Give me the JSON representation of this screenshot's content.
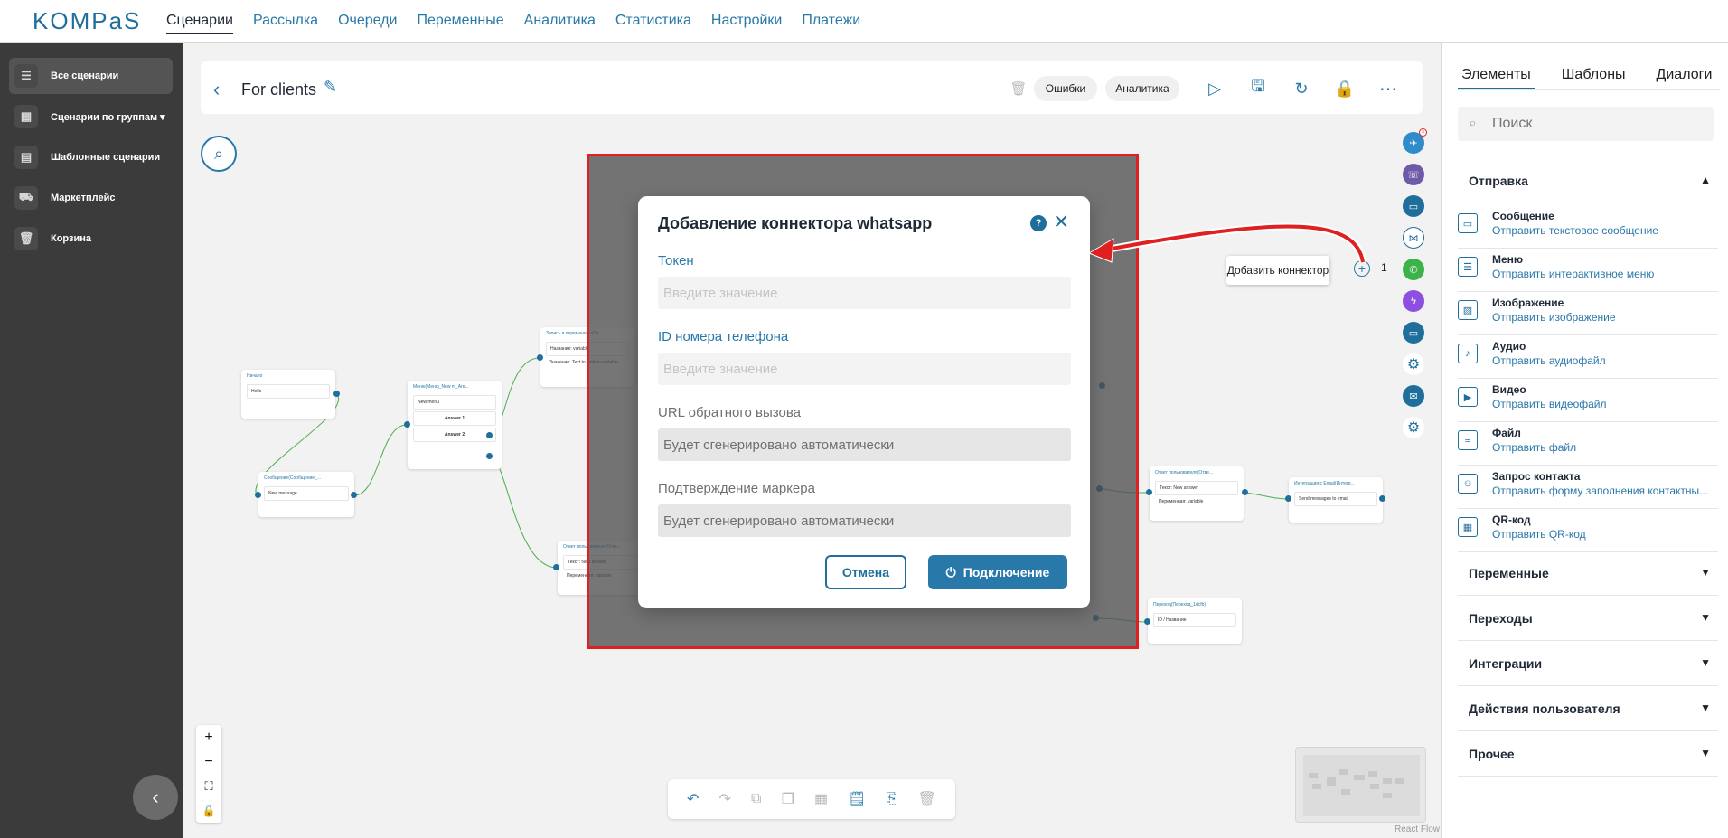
{
  "app": {
    "logo": "KOMPaS"
  },
  "topnav": [
    {
      "label": "Сценарии",
      "active": true
    },
    {
      "label": "Рассылка"
    },
    {
      "label": "Очереди"
    },
    {
      "label": "Переменные"
    },
    {
      "label": "Аналитика"
    },
    {
      "label": "Статистика"
    },
    {
      "label": "Настройки"
    },
    {
      "label": "Платежи"
    }
  ],
  "sidebar": {
    "items": [
      {
        "label": "Все сценарии",
        "icon": "list-icon",
        "active": true
      },
      {
        "label": "Сценарии по группам ▾",
        "icon": "grid-icon"
      },
      {
        "label": "Шаблонные сценарии",
        "icon": "template-icon"
      },
      {
        "label": "Маркетплейс",
        "icon": "cart-icon"
      },
      {
        "label": "Корзина",
        "icon": "trash-icon"
      }
    ]
  },
  "header": {
    "title": "For clients",
    "errors_label": "Ошибки",
    "analytics_label": "Аналитика"
  },
  "nodes": {
    "start": {
      "title": "Начало",
      "body": "Hello"
    },
    "message": {
      "title": "Сообщение(Сообщение_...",
      "body": "New message"
    },
    "menu": {
      "title": "Меню(Меню_New m_Are...",
      "body": "New menu",
      "answer1": "Answer 1",
      "answer2": "Answer 2"
    },
    "write_var": {
      "title": "Запись в переменную(За...",
      "line1": "Название: variable",
      "line2": "Значение: Text to write in variable"
    },
    "reply1": {
      "title": "Ответ пользователя(Отве...",
      "line1": "Текст: New answer",
      "line2": "Переменная: variable"
    },
    "reply2": {
      "title": "Ответ пользователя(Отве...",
      "line1": "Текст: New answer",
      "line2": "Переменная: variable"
    },
    "integration": {
      "title": "Интеграция с Email(Интегр...",
      "body": "Send messages to email"
    },
    "jump": {
      "title": "Переход(Переход_1dcfb)",
      "body": "ID / Название"
    },
    "hidden_msg": {
      "body": "New message"
    }
  },
  "modal": {
    "title": "Добавление коннектора whatsapp",
    "token_label": "Токен",
    "token_placeholder": "Введите значение",
    "phone_label": "ID номера телефона",
    "phone_placeholder": "Введите значение",
    "callback_label": "URL обратного вызова",
    "callback_value": "Будет сгенерировано автоматически",
    "marker_label": "Подтверждение маркера",
    "marker_value": "Будет сгенерировано автоматически",
    "cancel_label": "Отмена",
    "connect_label": "Подключение"
  },
  "connectors": {
    "tooltip": "Добавить коннектор",
    "count": "1"
  },
  "reactflow_label": "React Flow",
  "rpanel": {
    "tabs": [
      "Элементы",
      "Шаблоны",
      "Диалоги"
    ],
    "search_placeholder": "Поиск",
    "sections": {
      "send": "Отправка",
      "variables": "Переменные",
      "transitions": "Переходы",
      "integrations": "Интеграции",
      "user_actions": "Действия пользователя",
      "other": "Прочее"
    },
    "items": [
      {
        "title": "Сообщение",
        "desc": "Отправить текстовое сообщение"
      },
      {
        "title": "Меню",
        "desc": "Отправить интерактивное меню"
      },
      {
        "title": "Изображение",
        "desc": "Отправить изображение"
      },
      {
        "title": "Аудио",
        "desc": "Отправить аудиофайл"
      },
      {
        "title": "Видео",
        "desc": "Отправить видеофайл"
      },
      {
        "title": "Файл",
        "desc": "Отправить файл"
      },
      {
        "title": "Запрос контакта",
        "desc": "Отправить форму заполнения контактны..."
      },
      {
        "title": "QR-код",
        "desc": "Отправить QR-код"
      }
    ]
  },
  "colors": {
    "accent": "#2878a9",
    "sidebar": "#3b3b3b",
    "highlight": "#e02020",
    "edge": "#4caf50"
  }
}
